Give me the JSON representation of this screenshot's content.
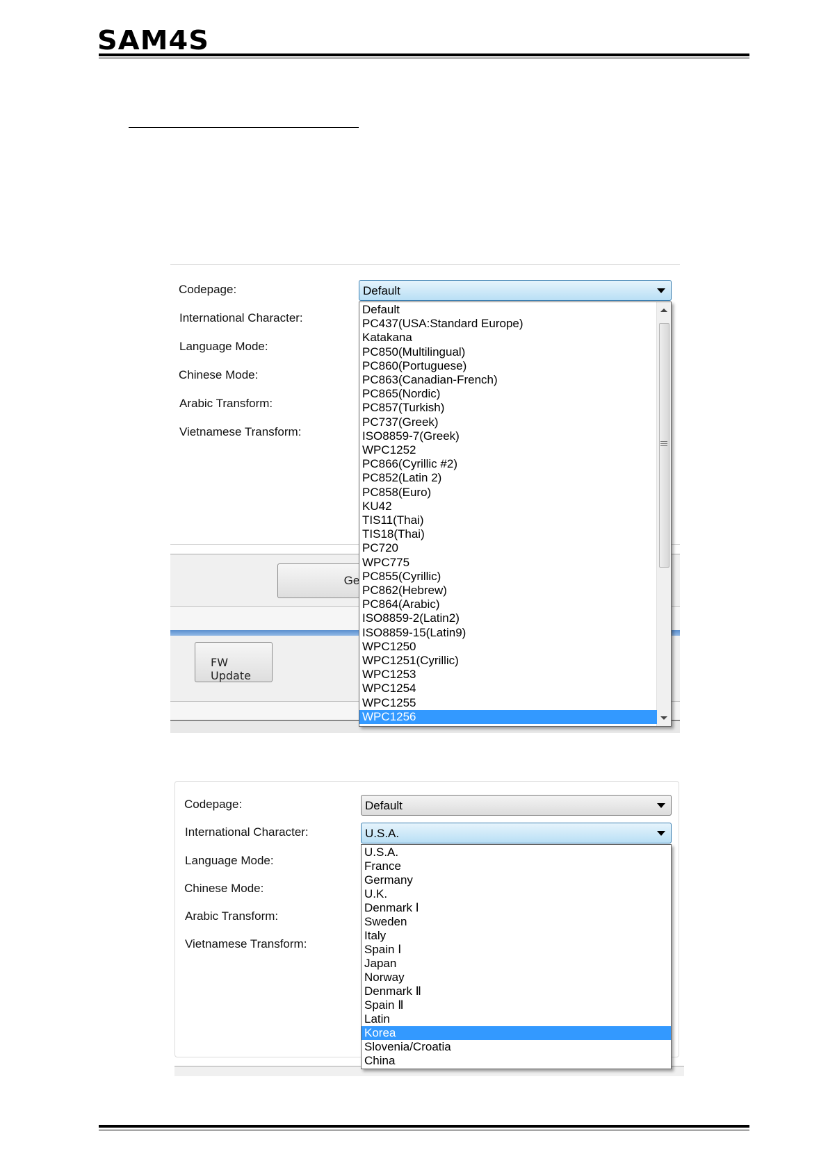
{
  "header": {
    "logo_text": "SAM4S"
  },
  "screenshot1": {
    "labels": [
      "Codepage:",
      "International Character:",
      "Language Mode:",
      "Chinese Mode:",
      "Arabic Transform:",
      "Vietnamese Transform:"
    ],
    "codepage_value": "Default",
    "get_button_label": "Get",
    "fw_update_label": "FW Update",
    "options": [
      "Default",
      "PC437(USA:Standard Europe)",
      "Katakana",
      "PC850(Multilingual)",
      "PC860(Portuguese)",
      "PC863(Canadian-French)",
      "PC865(Nordic)",
      "PC857(Turkish)",
      "PC737(Greek)",
      "ISO8859-7(Greek)",
      "WPC1252",
      "PC866(Cyrillic #2)",
      "PC852(Latin 2)",
      "PC858(Euro)",
      "KU42",
      "TIS11(Thai)",
      "TIS18(Thai)",
      "PC720",
      "WPC775",
      "PC855(Cyrillic)",
      "PC862(Hebrew)",
      "PC864(Arabic)",
      "ISO8859-2(Latin2)",
      "ISO8859-15(Latin9)",
      "WPC1250",
      "WPC1251(Cyrillic)",
      "WPC1253",
      "WPC1254",
      "WPC1255",
      "WPC1256"
    ],
    "selected": "WPC1256"
  },
  "screenshot2": {
    "labels": [
      "Codepage:",
      "International Character:",
      "Language Mode:",
      "Chinese Mode:",
      "Arabic Transform:",
      "Vietnamese Transform:"
    ],
    "codepage_value": "Default",
    "intl_value": "U.S.A.",
    "options": [
      "U.S.A.",
      "France",
      "Germany",
      "U.K.",
      "Denmark Ⅰ",
      "Sweden",
      "Italy",
      "Spain Ⅰ",
      "Japan",
      "Norway",
      "Denmark Ⅱ",
      "Spain Ⅱ",
      "Latin",
      "Korea",
      "Slovenia/Croatia",
      "China"
    ],
    "selected": "Korea"
  }
}
